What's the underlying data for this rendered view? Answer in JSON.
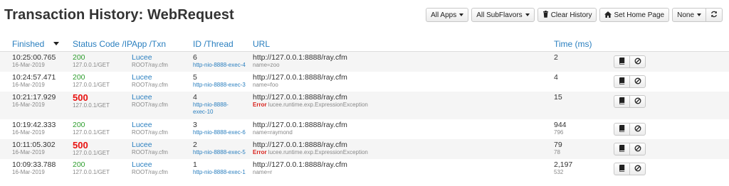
{
  "page": {
    "title": "Transaction History: WebRequest"
  },
  "toolbar": {
    "all_apps": "All Apps",
    "all_subflavors": "All SubFlavors",
    "clear_history": "Clear History",
    "set_home_page": "Set Home Page",
    "none": "None",
    "refresh_icon": "refresh-icon",
    "trash_icon": "trash-icon",
    "home_icon": "home-icon"
  },
  "table": {
    "columns": {
      "finished": "Finished",
      "status": "Status Code /IP",
      "app": "App /Txn",
      "id": "ID /Thread",
      "url": "URL",
      "time": "Time (ms)"
    },
    "rows": [
      {
        "time": "10:25:00.765",
        "date": "16-Mar-2019",
        "status": "200",
        "ip": "127.0.0.1/GET",
        "app": "Lucee",
        "txn": "ROOT/ray.cfm",
        "id": "6",
        "thread": "http-nio-8888-exec-4",
        "url": "http://127.0.0.1:8888/ray.cfm",
        "detail_prefix": "",
        "detail": "name=zoo",
        "ms": "2",
        "ms_sub": ""
      },
      {
        "time": "10:24:57.471",
        "date": "16-Mar-2019",
        "status": "200",
        "ip": "127.0.0.1/GET",
        "app": "Lucee",
        "txn": "ROOT/ray.cfm",
        "id": "5",
        "thread": "http-nio-8888-exec-3",
        "url": "http://127.0.0.1:8888/ray.cfm",
        "detail_prefix": "",
        "detail": "name=foo",
        "ms": "4",
        "ms_sub": ""
      },
      {
        "time": "10:21:17.929",
        "date": "16-Mar-2019",
        "status": "500",
        "ip": "127.0.0.1/GET",
        "app": "Lucee",
        "txn": "ROOT/ray.cfm",
        "id": "4",
        "thread": "http-nio-8888-",
        "thread2": "exec-10",
        "url": "http://127.0.0.1:8888/ray.cfm",
        "detail_prefix": "Error",
        "detail": "lucee.runtime.exp.ExpressionException",
        "ms": "15",
        "ms_sub": ""
      },
      {
        "time": "10:19:42.333",
        "date": "16-Mar-2019",
        "status": "200",
        "ip": "127.0.0.1/GET",
        "app": "Lucee",
        "txn": "ROOT/ray.cfm",
        "id": "3",
        "thread": "http-nio-8888-exec-6",
        "url": "http://127.0.0.1:8888/ray.cfm",
        "detail_prefix": "",
        "detail": "name=raymond",
        "ms": "944",
        "ms_sub": "796"
      },
      {
        "time": "10:11:05.302",
        "date": "16-Mar-2019",
        "status": "500",
        "ip": "127.0.0.1/GET",
        "app": "Lucee",
        "txn": "ROOT/ray.cfm",
        "id": "2",
        "thread": "http-nio-8888-exec-5",
        "url": "http://127.0.0.1:8888/ray.cfm",
        "detail_prefix": "Error",
        "detail": "lucee.runtime.exp.ExpressionException",
        "ms": "79",
        "ms_sub": "78"
      },
      {
        "time": "10:09:33.788",
        "date": "16-Mar-2019",
        "status": "200",
        "ip": "127.0.0.1/GET",
        "app": "Lucee",
        "txn": "ROOT/ray.cfm",
        "id": "1",
        "thread": "http-nio-8888-exec-1",
        "url": "http://127.0.0.1:8888/ray.cfm",
        "detail_prefix": "",
        "detail": "name=r",
        "ms": "2,197",
        "ms_sub": "532"
      }
    ],
    "row_actions": {
      "view_icon": "book-icon",
      "ignore_icon": "ban-icon"
    }
  },
  "colors": {
    "accent": "#2a7fbf",
    "ok": "#2e9e2e",
    "error": "#e8110f",
    "alt_row": "#f5f5f5"
  }
}
